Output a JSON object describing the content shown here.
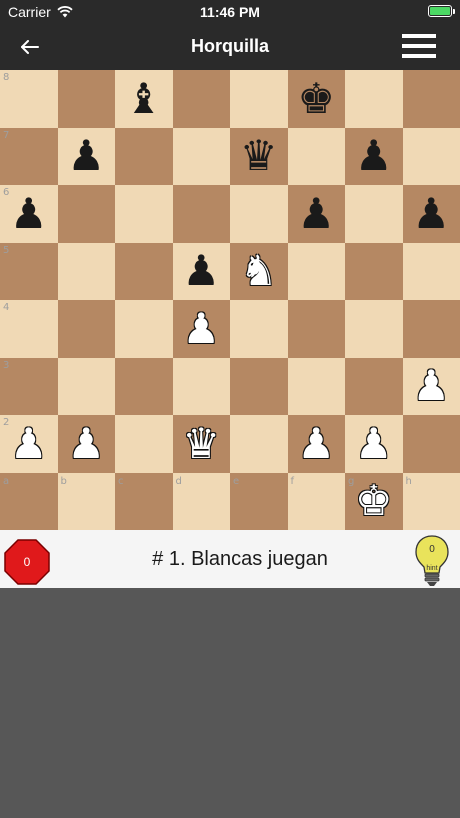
{
  "status_bar": {
    "carrier": "Carrier",
    "time": "11:46 PM",
    "battery_percent": 100
  },
  "nav": {
    "title": "Horquilla",
    "back_icon": "back-arrow-icon",
    "menu_icon": "hamburger-menu-icon"
  },
  "board": {
    "light_color": "#f0d9b5",
    "dark_color": "#b58863",
    "rank_labels": [
      "8",
      "7",
      "6",
      "5",
      "4",
      "3",
      "2"
    ],
    "file_labels": [
      "a",
      "b",
      "c",
      "d",
      "e",
      "f",
      "g",
      "h"
    ],
    "pieces": [
      {
        "square": "c8",
        "color": "black",
        "type": "bishop",
        "glyph": "♝"
      },
      {
        "square": "f8",
        "color": "black",
        "type": "king",
        "glyph": "♚"
      },
      {
        "square": "b7",
        "color": "black",
        "type": "pawn",
        "glyph": "♟"
      },
      {
        "square": "e7",
        "color": "black",
        "type": "queen",
        "glyph": "♛"
      },
      {
        "square": "g7",
        "color": "black",
        "type": "pawn",
        "glyph": "♟"
      },
      {
        "square": "a6",
        "color": "black",
        "type": "pawn",
        "glyph": "♟"
      },
      {
        "square": "f6",
        "color": "black",
        "type": "pawn",
        "glyph": "♟"
      },
      {
        "square": "h6",
        "color": "black",
        "type": "pawn",
        "glyph": "♟"
      },
      {
        "square": "d5",
        "color": "black",
        "type": "pawn",
        "glyph": "♟"
      },
      {
        "square": "e5",
        "color": "white",
        "type": "knight",
        "glyph": "♞"
      },
      {
        "square": "d4",
        "color": "white",
        "type": "pawn",
        "glyph": "♟"
      },
      {
        "square": "h3",
        "color": "white",
        "type": "pawn",
        "glyph": "♟"
      },
      {
        "square": "a2",
        "color": "white",
        "type": "pawn",
        "glyph": "♟"
      },
      {
        "square": "b2",
        "color": "white",
        "type": "pawn",
        "glyph": "♟"
      },
      {
        "square": "d2",
        "color": "white",
        "type": "queen",
        "glyph": "♛"
      },
      {
        "square": "f2",
        "color": "white",
        "type": "pawn",
        "glyph": "♟"
      },
      {
        "square": "g2",
        "color": "white",
        "type": "pawn",
        "glyph": "♟"
      },
      {
        "square": "g1",
        "color": "white",
        "type": "king",
        "glyph": "♚"
      }
    ]
  },
  "info": {
    "mistakes_count": "0",
    "mistakes_color": "#e0191b",
    "puzzle_title": "# 1. Blancas juegan",
    "hint_count": "0",
    "hint_label": "hint",
    "hint_color": "#e9e35b"
  }
}
